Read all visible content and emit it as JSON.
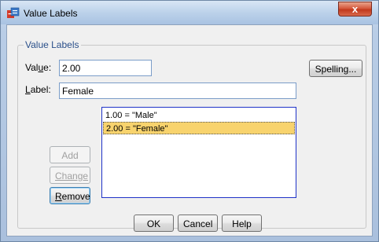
{
  "window": {
    "title": "Value Labels",
    "close_glyph": "x"
  },
  "group": {
    "legend": "Value Labels"
  },
  "value_field": {
    "label_prefix": "Val",
    "label_accel": "u",
    "label_suffix": "e:",
    "value": "2.00"
  },
  "label_field": {
    "label_accel": "L",
    "label_suffix": "abel:",
    "value": "Female"
  },
  "buttons": {
    "spelling": "Spelling...",
    "add": "Add",
    "change": "Change",
    "remove_accel": "R",
    "remove_rest": "emove",
    "ok": "OK",
    "cancel": "Cancel",
    "help": "Help"
  },
  "list": {
    "items": [
      {
        "text": "1.00 = \"Male\""
      },
      {
        "text": "2.00 = \"Female\""
      }
    ],
    "selected_index": 1
  },
  "colors": {
    "selection": "#f8d36d",
    "listbox_border": "#1f33c8",
    "legend_text": "#2a4f8a"
  }
}
